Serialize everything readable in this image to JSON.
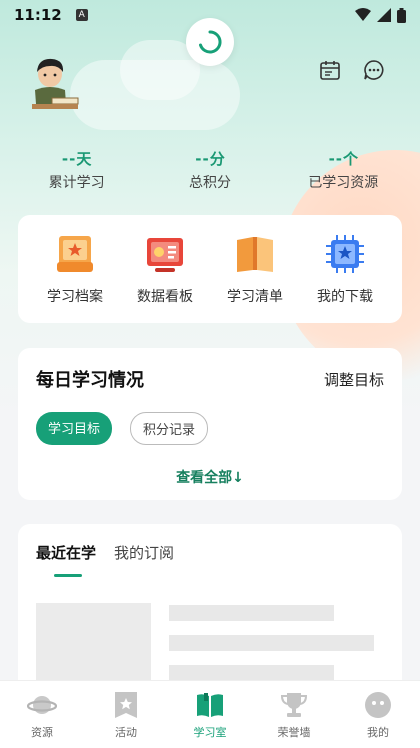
{
  "status_bar": {
    "time": "11:12",
    "a_badge": "A"
  },
  "header": {
    "calendar_icon": "calendar-icon",
    "message_icon": "chat-icon"
  },
  "stats": [
    {
      "value": "--",
      "unit": "天",
      "label": "累计学习"
    },
    {
      "value": "--",
      "unit": "分",
      "label": "总积分"
    },
    {
      "value": "--",
      "unit": "个",
      "label": "已学习资源"
    }
  ],
  "quick": [
    {
      "label": "学习档案",
      "icon": "archive-icon"
    },
    {
      "label": "数据看板",
      "icon": "dashboard-icon"
    },
    {
      "label": "学习清单",
      "icon": "book-list-icon"
    },
    {
      "label": "我的下载",
      "icon": "download-chip-icon"
    }
  ],
  "daily": {
    "title": "每日学习情况",
    "adjust": "调整目标",
    "chip_goal": "学习目标",
    "chip_points": "积分记录",
    "view_all": "查看全部↓"
  },
  "recent": {
    "tab_recent": "最近在学",
    "tab_subscriptions": "我的订阅"
  },
  "tabbar": [
    {
      "label": "资源",
      "icon": "planet-icon",
      "active": false
    },
    {
      "label": "活动",
      "icon": "bookmark-star-icon",
      "active": false
    },
    {
      "label": "学习室",
      "icon": "book-open-icon",
      "active": true
    },
    {
      "label": "荣誉墙",
      "icon": "trophy-icon",
      "active": false
    },
    {
      "label": "我的",
      "icon": "face-icon",
      "active": false
    }
  ],
  "colors": {
    "accent": "#17a078",
    "stat_value": "#1a9873"
  }
}
